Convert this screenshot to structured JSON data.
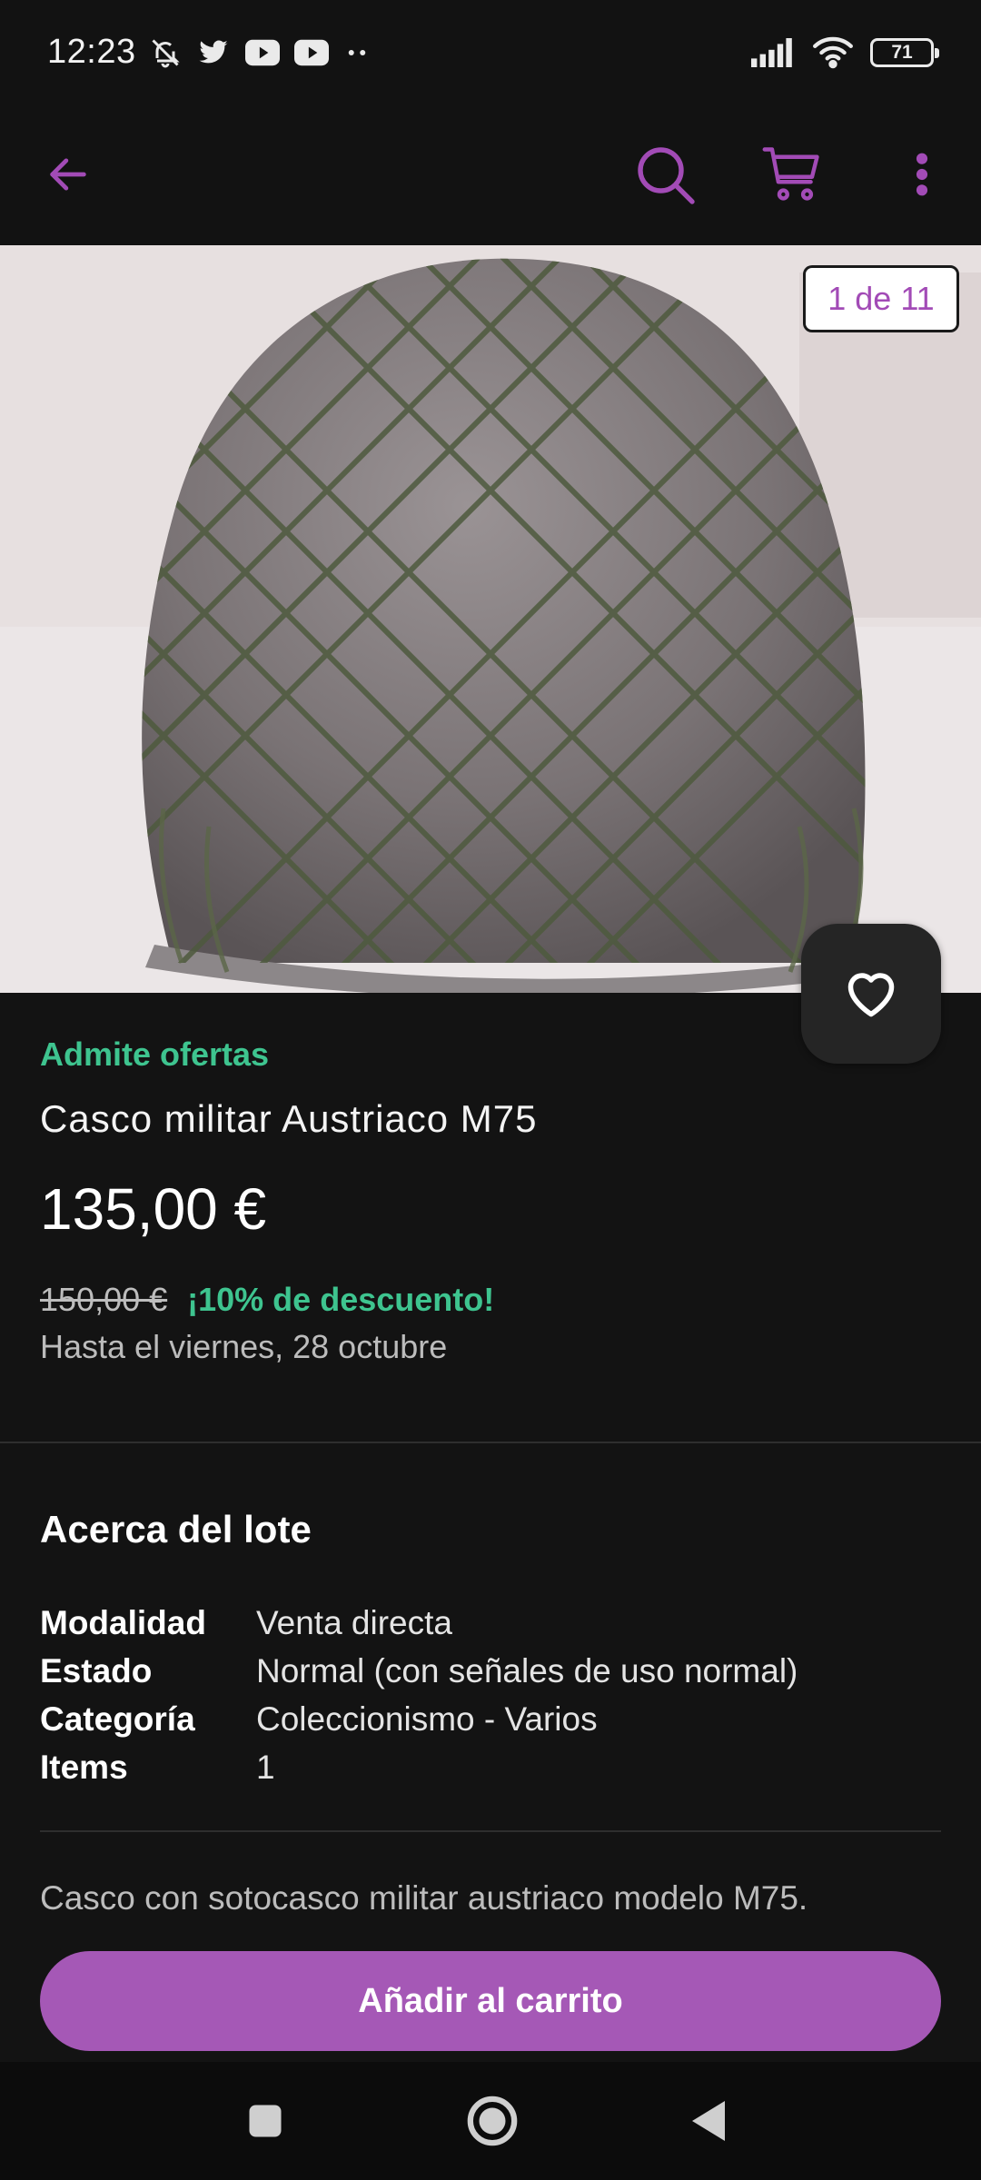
{
  "status_bar": {
    "time": "12:23",
    "battery": "71",
    "icons": [
      "bell-off-icon",
      "twitter-icon",
      "youtube-icon",
      "youtube-icon",
      "more-dots-icon",
      "signal-icon",
      "wifi-icon",
      "battery-icon"
    ]
  },
  "app_bar": {
    "icons": [
      "back-arrow-icon",
      "search-icon",
      "cart-icon",
      "more-vertical-icon"
    ],
    "accent_color": "#a24bb6"
  },
  "gallery": {
    "counter": "1 de 11",
    "image_description": "helmet-with-net-photo"
  },
  "product": {
    "offers_label": "Admite ofertas",
    "title": "Casco militar Austriaco M75",
    "price": "135,00 €",
    "old_price": "150,00 €",
    "discount": "¡10% de descuento!",
    "until": "Hasta el viernes, 28 octubre"
  },
  "about": {
    "title": "Acerca del lote",
    "rows": [
      {
        "label": "Modalidad",
        "value": "Venta directa"
      },
      {
        "label": "Estado",
        "value": "Normal (con señales de uso normal)"
      },
      {
        "label": "Categoría",
        "value": "Coleccionismo - Varios"
      },
      {
        "label": "Items",
        "value": "1"
      }
    ],
    "description": "Casco con sotocasco militar austriaco modelo M75."
  },
  "cart_button": {
    "label": "Añadir al carrito"
  },
  "colors": {
    "accent": "#a558b6",
    "success": "#3ec48f",
    "background": "#131313"
  }
}
